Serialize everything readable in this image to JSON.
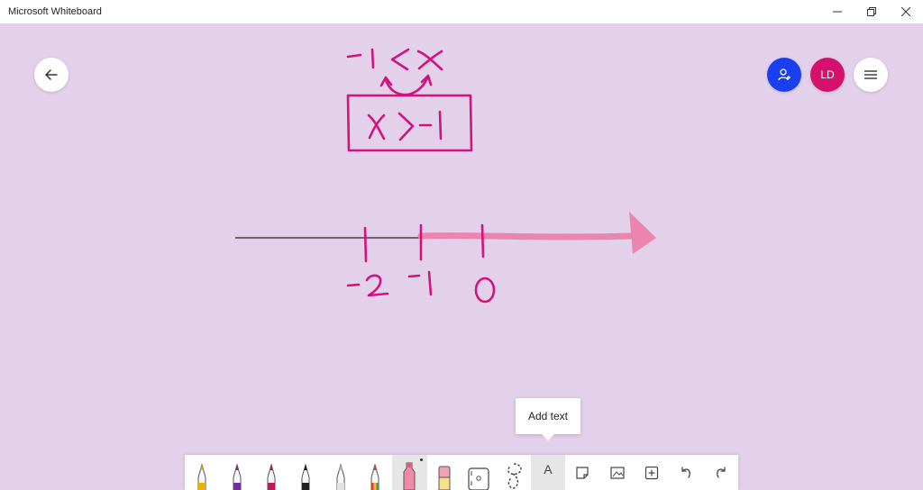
{
  "window": {
    "title": "Microsoft Whiteboard",
    "controls": [
      "minimize-icon",
      "restore-icon",
      "close-icon"
    ]
  },
  "top_controls": {
    "back_icon": "arrow-left-icon",
    "invite_icon": "invite-person-icon",
    "avatar_initials": "LD",
    "menu_icon": "hamburger-icon"
  },
  "tooltip": {
    "text": "Add text"
  },
  "toolbar": {
    "tools": [
      {
        "name": "yellow-pen",
        "color": "#e8b400"
      },
      {
        "name": "purple-pen",
        "color": "#6b2fa0"
      },
      {
        "name": "magenta-pen",
        "color": "#c2185b"
      },
      {
        "name": "black-pen",
        "color": "#222222"
      },
      {
        "name": "white-pen",
        "color": "#f2f2f2"
      },
      {
        "name": "rainbow-pen",
        "color": "#e53935"
      },
      {
        "name": "highlighter",
        "color": "#f08aa8"
      },
      {
        "name": "eraser",
        "color": "#f4a0b4"
      },
      {
        "name": "ruler",
        "color": "#ffffff"
      },
      {
        "name": "lasso-select",
        "color": "#ffffff"
      }
    ],
    "text_tool_label": "A",
    "action_icons": [
      "sticky-note-icon",
      "image-icon",
      "insert-icon",
      "undo-icon",
      "redo-icon"
    ]
  },
  "ink_colors": {
    "pink": "#d4137a",
    "highlight": "#ec85ae"
  }
}
